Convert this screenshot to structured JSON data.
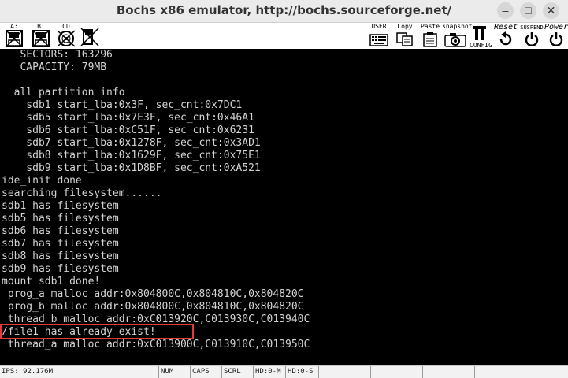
{
  "window": {
    "title": "Bochs x86 emulator, http://bochs.sourceforge.net/"
  },
  "toolbar": {
    "floppy_a": "A:",
    "floppy_b": "B:",
    "cdrom": "CD",
    "user": "USER",
    "copy": "Copy",
    "paste": "Paste",
    "snapshot": "snapshot",
    "config": "CONFIG",
    "reset": "Reset",
    "suspend": "SUSPEND",
    "power": "Power"
  },
  "terminal": {
    "lines": [
      "   SECTORS: 163296",
      "   CAPACITY: 79MB",
      "",
      "  all partition info",
      "    sdb1 start_lba:0x3F, sec_cnt:0x7DC1",
      "    sdb5 start_lba:0x7E3F, sec_cnt:0x46A1",
      "    sdb6 start_lba:0xC51F, sec_cnt:0x6231",
      "    sdb7 start_lba:0x1278F, sec_cnt:0x3AD1",
      "    sdb8 start_lba:0x1629F, sec_cnt:0x75E1",
      "    sdb9 start_lba:0x1D8BF, sec_cnt:0xA521",
      "ide_init done",
      "searching filesystem......",
      "sdb1 has filesystem",
      "sdb5 has filesystem",
      "sdb6 has filesystem",
      "sdb7 has filesystem",
      "sdb8 has filesystem",
      "sdb9 has filesystem",
      "mount sdb1 done!",
      " prog_a malloc addr:0x804800C,0x804810C,0x804820C",
      " prog_b malloc addr:0x804800C,0x804810C,0x804820C",
      " thread_b malloc addr:0xC013920C,C013930C,C013940C",
      "/file1 has already exist!",
      " thread_a malloc addr:0xC013900C,C013910C,C013950C"
    ]
  },
  "status": {
    "ips": "IPS: 92.176M",
    "num": "NUM",
    "caps": "CAPS",
    "scrl": "SCRL",
    "hd0m": "HD:0-M",
    "hd0s": "HD:0-S"
  }
}
